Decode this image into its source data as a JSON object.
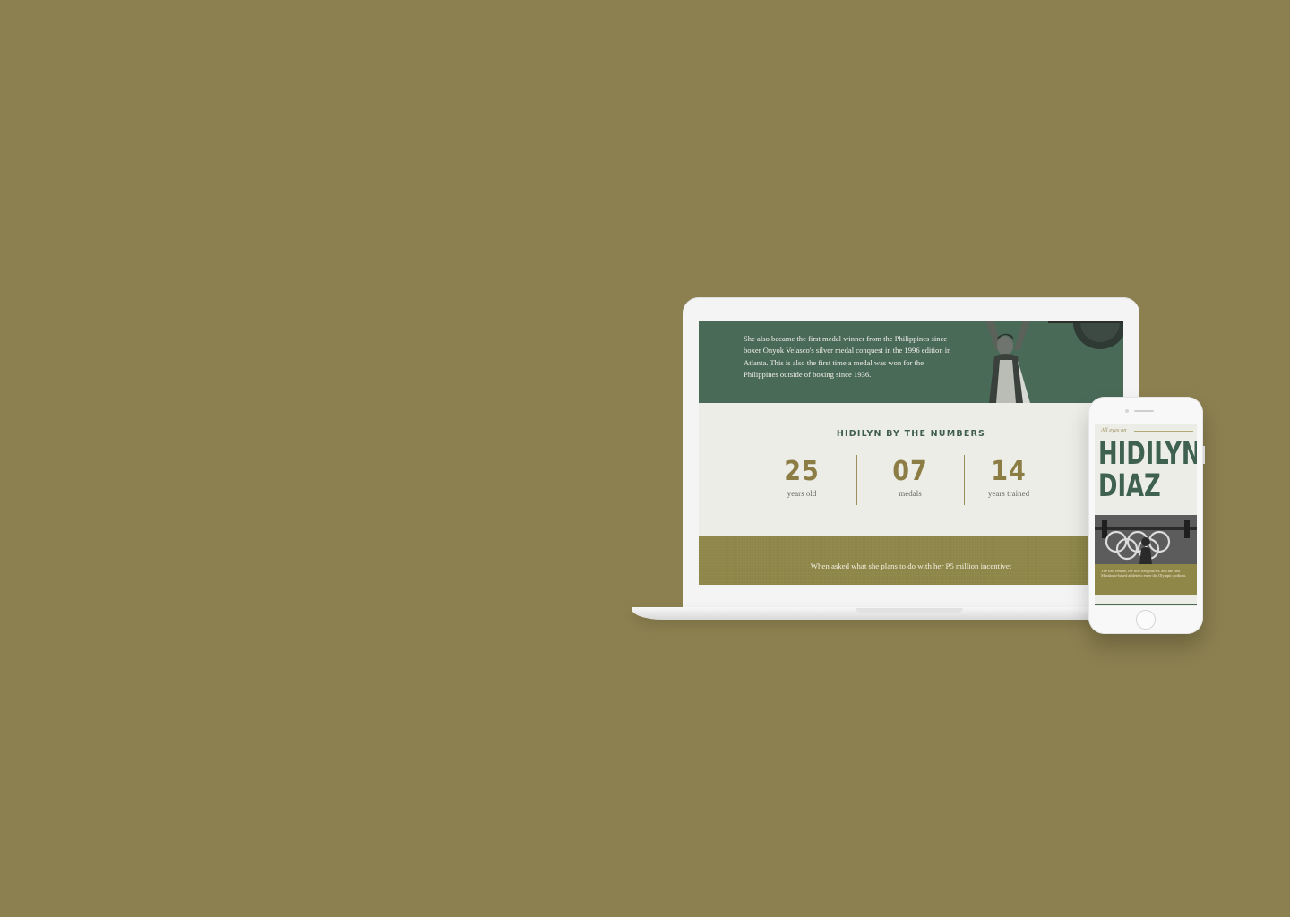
{
  "laptop": {
    "hero": {
      "paragraph": "She also became the first medal winner from the Philippines since boxer Onyok Velasco's silver medal conquest in the 1996 edition in Atlanta. This is also the first time a medal was won for the Philippines outside of boxing since 1936."
    },
    "stats": {
      "title": "HIDILYN BY THE NUMBERS",
      "items": [
        {
          "value": "25",
          "label": "years old"
        },
        {
          "value": "07",
          "label": "medals"
        },
        {
          "value": "14",
          "label": "years trained"
        }
      ]
    },
    "quote": {
      "text": "When asked what she plans to do with her P5 million incentive:"
    }
  },
  "phone": {
    "eyebrow": "All eyes on",
    "title_line1": "HIDILYN",
    "title_line2": "DIAZ",
    "caption": "The first female, the first weightlifter, and the first Mindanao-based athlete to enter the Olympic podium."
  },
  "colors": {
    "background": "#8c8050",
    "green": "#4a6a58",
    "olive": "#8d8648",
    "gold": "#8c7d45"
  }
}
